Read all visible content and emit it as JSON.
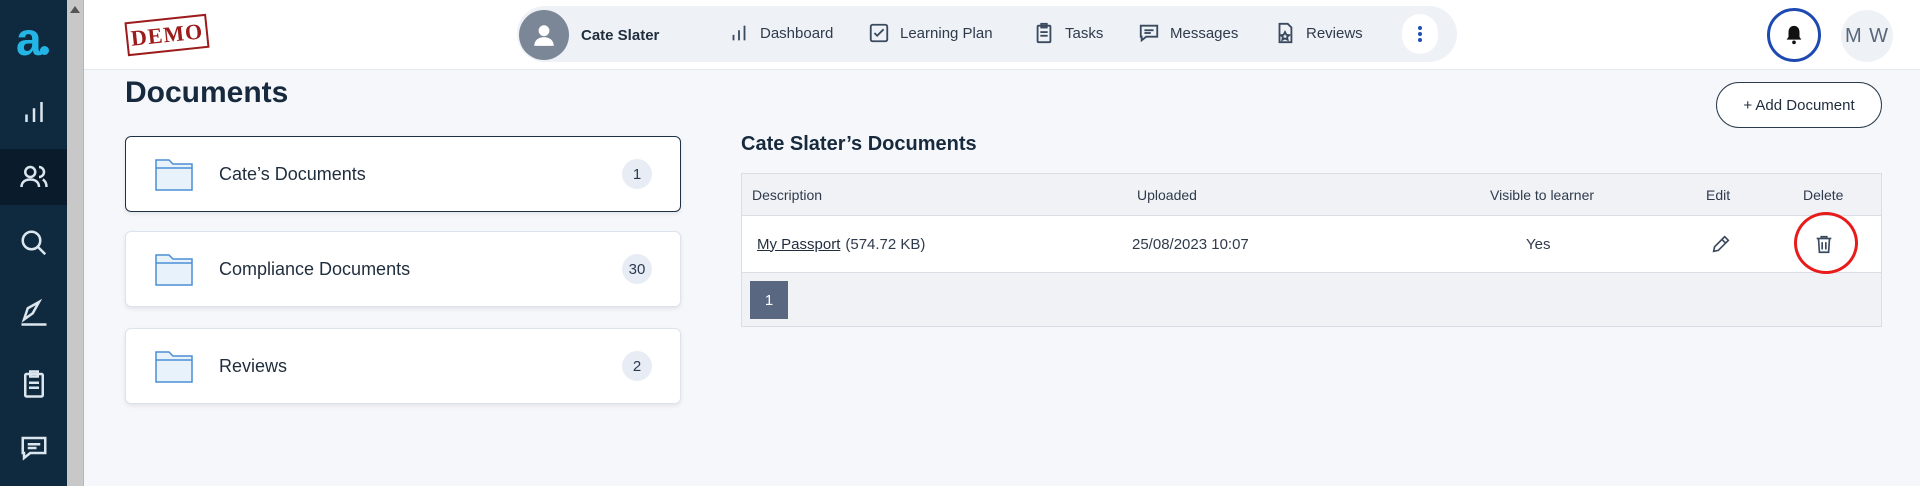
{
  "topbar": {
    "demo_stamp": "DEMO",
    "learner_name": "Cate Slater",
    "nav": [
      {
        "label": "Dashboard",
        "icon": "bar-chart-icon"
      },
      {
        "label": "Learning Plan",
        "icon": "checkbox-icon"
      },
      {
        "label": "Tasks",
        "icon": "clipboard-icon"
      },
      {
        "label": "Messages",
        "icon": "message-icon"
      },
      {
        "label": "Reviews",
        "icon": "review-icon"
      }
    ],
    "user_initials": "M W"
  },
  "sidebar": {
    "items": [
      {
        "icon": "bar-chart-icon"
      },
      {
        "icon": "users-icon",
        "active": true
      },
      {
        "icon": "search-icon"
      },
      {
        "icon": "pen-icon"
      },
      {
        "icon": "clipboard-icon"
      },
      {
        "icon": "message-icon"
      }
    ]
  },
  "main": {
    "title": "Documents",
    "add_button": "+ Add Document",
    "folders": [
      {
        "label": "Cate’s Documents",
        "count": "1",
        "active": true
      },
      {
        "label": "Compliance Documents",
        "count": "30"
      },
      {
        "label": "Reviews",
        "count": "2"
      }
    ],
    "docs_title": "Cate Slater’s Documents",
    "table": {
      "headers": [
        "Description",
        "Uploaded",
        "Visible to learner",
        "Edit",
        "Delete"
      ],
      "rows": [
        {
          "name": "My Passport",
          "size": "(574.72 KB)",
          "uploaded": "25/08/2023 10:07",
          "visible": "Yes"
        }
      ]
    },
    "page": "1"
  },
  "colors": {
    "sidebar": "#0f2a3f",
    "brand": "#22b5e6",
    "accent": "#1d49b1",
    "highlight": "#e81b1b"
  }
}
